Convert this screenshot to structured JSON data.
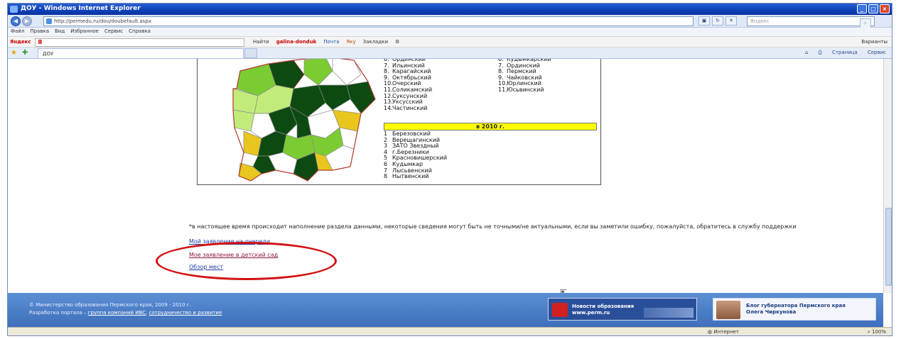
{
  "window": {
    "title": "ДОУ - Windows Internet Explorer",
    "buttons": {
      "minimize": "_",
      "maximize": "□",
      "close": "×"
    }
  },
  "address_bar": {
    "url": "http://permedu.ru/dou/doubefault.aspx",
    "search_placeholder": "Яндекс"
  },
  "menu": [
    "Файл",
    "Правка",
    "Вид",
    "Избранное",
    "Сервис",
    "Справка"
  ],
  "yandex_toolbar": {
    "logo": "Яндекс",
    "query": "Я",
    "buttons": [
      "Найти",
      "galina-donduk",
      "Почта",
      "Яку",
      "Закладки"
    ],
    "right": "Варианты"
  },
  "tabs": {
    "active": "ДОУ",
    "commands": [
      "Страница",
      "Сервис"
    ]
  },
  "map": {
    "list_a": [
      {
        "n": "6.",
        "name": "Ординский"
      },
      {
        "n": "7.",
        "name": "Ильинский"
      },
      {
        "n": "8.",
        "name": "Карагайский"
      },
      {
        "n": "9.",
        "name": "Октябрьский"
      },
      {
        "n": "10.",
        "name": "Очерский"
      },
      {
        "n": "11.",
        "name": "Соликамский"
      },
      {
        "n": "12.",
        "name": "Суксунский"
      },
      {
        "n": "13.",
        "name": "Уксусский"
      },
      {
        "n": "14.",
        "name": "Частинский"
      }
    ],
    "list_b": [
      {
        "n": "6.",
        "name": "Кудымкарский"
      },
      {
        "n": "7.",
        "name": "Ординский"
      },
      {
        "n": "8.",
        "name": "Пермский"
      },
      {
        "n": "9.",
        "name": "Чайковский"
      },
      {
        "n": "10.",
        "name": "Юрлинский"
      },
      {
        "n": "11.",
        "name": "Юсьвинский"
      }
    ],
    "year_band": "в 2010 г.",
    "list_c": [
      {
        "n": "1",
        "name": "Березовский"
      },
      {
        "n": "2",
        "name": "Верещагинский"
      },
      {
        "n": "3",
        "name": "ЗАТО Звездный"
      },
      {
        "n": "4",
        "name": "г.Березники"
      },
      {
        "n": "5",
        "name": "Красновишерский"
      },
      {
        "n": "6",
        "name": "Кудымкар"
      },
      {
        "n": "7",
        "name": "Лысьвенский"
      },
      {
        "n": "8",
        "name": "Нытвенский"
      }
    ],
    "colors": {
      "dark": "#0d4a12",
      "mid": "#7bcc33",
      "light": "#c2ec7a",
      "yellow": "#e8c61d",
      "white": "#ffffff",
      "border": "#b33a2a"
    }
  },
  "notice": "*в настоящее время происходит наполнение раздела данными, некоторые сведения могут быть не точными/не актуальными, если вы заметили ошибку, пожалуйста, обратитесь в службу поддержки",
  "links": {
    "link1": "Мой заявление на очереди",
    "link2": "Мое заявление в детский сад",
    "link3": "Обзор мест"
  },
  "footer": {
    "copyright": "© Министерство образования Пермского края, 2009 - 2010 г.",
    "dev_prefix": "Разработка портала – ",
    "dev_link1": "группа компаний ИВС",
    "dev_sep": ", ",
    "dev_link2": "сотрудничество и развитие",
    "news_banner_title": "Новости образования",
    "news_banner_url": "www.perm.ru",
    "gov_banner_title": "Блог губернатора Пермского края",
    "gov_banner_name": "Олега Чиркунова"
  },
  "status": {
    "zone": "Интернет",
    "zoom": "100%"
  }
}
